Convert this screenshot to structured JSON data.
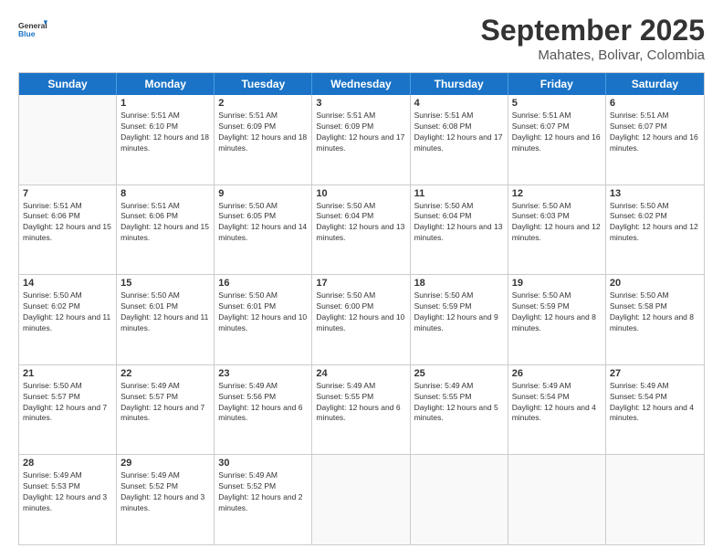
{
  "logo": {
    "line1": "General",
    "line2": "Blue"
  },
  "title": "September 2025",
  "subtitle": "Mahates, Bolivar, Colombia",
  "days": [
    "Sunday",
    "Monday",
    "Tuesday",
    "Wednesday",
    "Thursday",
    "Friday",
    "Saturday"
  ],
  "weeks": [
    [
      {
        "day": "",
        "empty": true
      },
      {
        "day": "1",
        "sunrise": "5:51 AM",
        "sunset": "6:10 PM",
        "daylight": "12 hours and 18 minutes."
      },
      {
        "day": "2",
        "sunrise": "5:51 AM",
        "sunset": "6:09 PM",
        "daylight": "12 hours and 18 minutes."
      },
      {
        "day": "3",
        "sunrise": "5:51 AM",
        "sunset": "6:09 PM",
        "daylight": "12 hours and 17 minutes."
      },
      {
        "day": "4",
        "sunrise": "5:51 AM",
        "sunset": "6:08 PM",
        "daylight": "12 hours and 17 minutes."
      },
      {
        "day": "5",
        "sunrise": "5:51 AM",
        "sunset": "6:07 PM",
        "daylight": "12 hours and 16 minutes."
      },
      {
        "day": "6",
        "sunrise": "5:51 AM",
        "sunset": "6:07 PM",
        "daylight": "12 hours and 16 minutes."
      }
    ],
    [
      {
        "day": "7",
        "sunrise": "5:51 AM",
        "sunset": "6:06 PM",
        "daylight": "12 hours and 15 minutes."
      },
      {
        "day": "8",
        "sunrise": "5:51 AM",
        "sunset": "6:06 PM",
        "daylight": "12 hours and 15 minutes."
      },
      {
        "day": "9",
        "sunrise": "5:50 AM",
        "sunset": "6:05 PM",
        "daylight": "12 hours and 14 minutes."
      },
      {
        "day": "10",
        "sunrise": "5:50 AM",
        "sunset": "6:04 PM",
        "daylight": "12 hours and 13 minutes."
      },
      {
        "day": "11",
        "sunrise": "5:50 AM",
        "sunset": "6:04 PM",
        "daylight": "12 hours and 13 minutes."
      },
      {
        "day": "12",
        "sunrise": "5:50 AM",
        "sunset": "6:03 PM",
        "daylight": "12 hours and 12 minutes."
      },
      {
        "day": "13",
        "sunrise": "5:50 AM",
        "sunset": "6:02 PM",
        "daylight": "12 hours and 12 minutes."
      }
    ],
    [
      {
        "day": "14",
        "sunrise": "5:50 AM",
        "sunset": "6:02 PM",
        "daylight": "12 hours and 11 minutes."
      },
      {
        "day": "15",
        "sunrise": "5:50 AM",
        "sunset": "6:01 PM",
        "daylight": "12 hours and 11 minutes."
      },
      {
        "day": "16",
        "sunrise": "5:50 AM",
        "sunset": "6:01 PM",
        "daylight": "12 hours and 10 minutes."
      },
      {
        "day": "17",
        "sunrise": "5:50 AM",
        "sunset": "6:00 PM",
        "daylight": "12 hours and 10 minutes."
      },
      {
        "day": "18",
        "sunrise": "5:50 AM",
        "sunset": "5:59 PM",
        "daylight": "12 hours and 9 minutes."
      },
      {
        "day": "19",
        "sunrise": "5:50 AM",
        "sunset": "5:59 PM",
        "daylight": "12 hours and 8 minutes."
      },
      {
        "day": "20",
        "sunrise": "5:50 AM",
        "sunset": "5:58 PM",
        "daylight": "12 hours and 8 minutes."
      }
    ],
    [
      {
        "day": "21",
        "sunrise": "5:50 AM",
        "sunset": "5:57 PM",
        "daylight": "12 hours and 7 minutes."
      },
      {
        "day": "22",
        "sunrise": "5:49 AM",
        "sunset": "5:57 PM",
        "daylight": "12 hours and 7 minutes."
      },
      {
        "day": "23",
        "sunrise": "5:49 AM",
        "sunset": "5:56 PM",
        "daylight": "12 hours and 6 minutes."
      },
      {
        "day": "24",
        "sunrise": "5:49 AM",
        "sunset": "5:55 PM",
        "daylight": "12 hours and 6 minutes."
      },
      {
        "day": "25",
        "sunrise": "5:49 AM",
        "sunset": "5:55 PM",
        "daylight": "12 hours and 5 minutes."
      },
      {
        "day": "26",
        "sunrise": "5:49 AM",
        "sunset": "5:54 PM",
        "daylight": "12 hours and 4 minutes."
      },
      {
        "day": "27",
        "sunrise": "5:49 AM",
        "sunset": "5:54 PM",
        "daylight": "12 hours and 4 minutes."
      }
    ],
    [
      {
        "day": "28",
        "sunrise": "5:49 AM",
        "sunset": "5:53 PM",
        "daylight": "12 hours and 3 minutes."
      },
      {
        "day": "29",
        "sunrise": "5:49 AM",
        "sunset": "5:52 PM",
        "daylight": "12 hours and 3 minutes."
      },
      {
        "day": "30",
        "sunrise": "5:49 AM",
        "sunset": "5:52 PM",
        "daylight": "12 hours and 2 minutes."
      },
      {
        "day": "",
        "empty": true
      },
      {
        "day": "",
        "empty": true
      },
      {
        "day": "",
        "empty": true
      },
      {
        "day": "",
        "empty": true
      }
    ]
  ]
}
